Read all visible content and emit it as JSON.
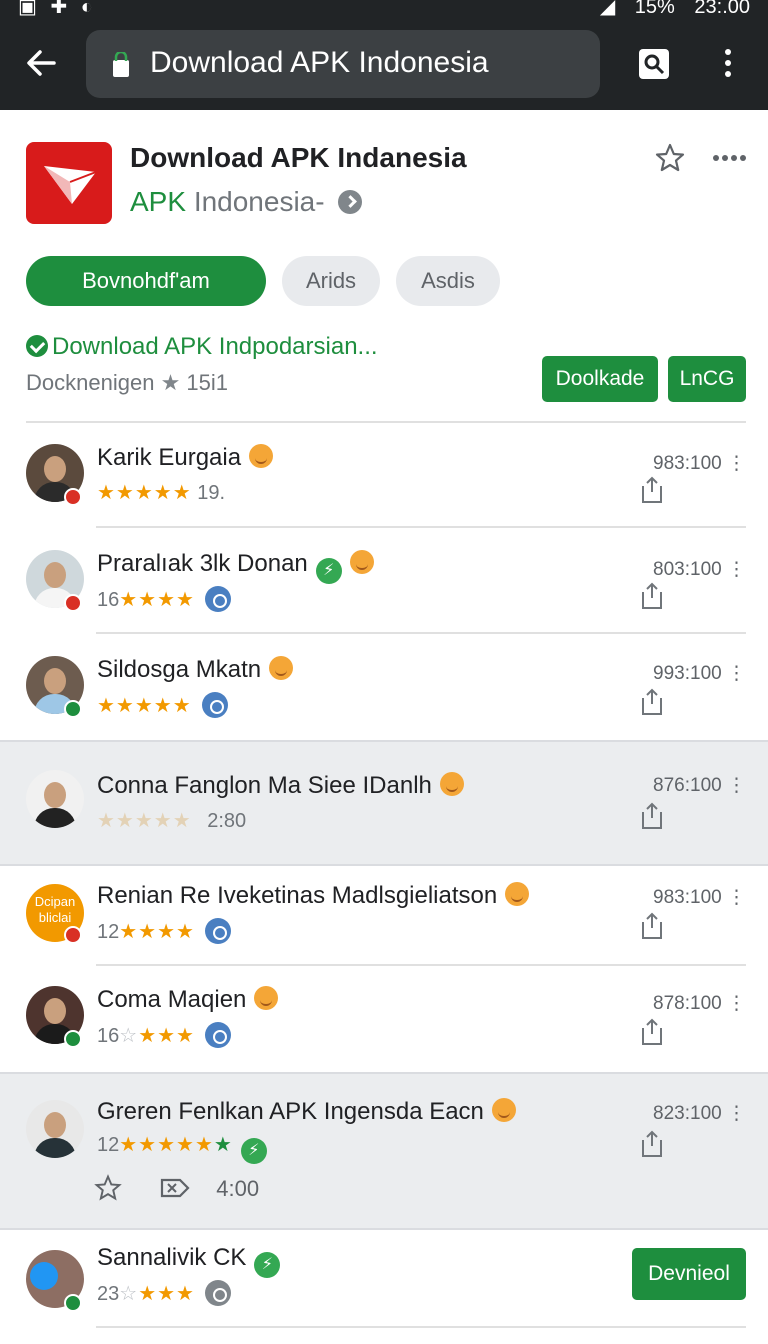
{
  "browser": {
    "url_text": "Download APK Indonesia",
    "status_time": "23:.00",
    "battery": "15%"
  },
  "app": {
    "title": "Download APK Indanesia",
    "developer_brand": "APK",
    "developer_rest": "Indonesia-",
    "chips": [
      "Bovnohdf'am",
      "Arids",
      "Asdis"
    ]
  },
  "summary": {
    "title": "Download APK Indpodarsian...",
    "meta_prefix": "Docknenigen",
    "meta_value": "15i1",
    "btn_primary": "Doolkade",
    "btn_secondary": "LnCG"
  },
  "reviews": [
    {
      "name": "Karik Eurgaia",
      "meta": "19.",
      "timer": "983:100"
    },
    {
      "name": "Praralıak 3lk Donan",
      "meta": "16",
      "timer": "803:100"
    },
    {
      "name": "Sildosga Mkatn",
      "meta": "",
      "timer": "993:100"
    },
    {
      "name": "Conna Fanglon Ma Siee IDanlh",
      "meta": "2:80",
      "timer": "876:100"
    },
    {
      "name": "Renian Re Ivеketinas Madlsgieliatson",
      "meta": "12",
      "avatar_text": "Dcipan bliclai",
      "timer": "983:100"
    },
    {
      "name": "Coma Maqien",
      "meta": "16",
      "timer": "878:100"
    },
    {
      "name": "Greren Fenlkan APK Ingensda Eacn",
      "meta": "12",
      "extra_time": "4:00",
      "timer": "823:100"
    },
    {
      "name": "Sannalivik CK",
      "meta": "23",
      "timer": "",
      "button": "Devnieol"
    }
  ],
  "colors": {
    "accent_green": "#1e8e3e",
    "app_icon_red": "#d81b1b",
    "top_bar": "#212426",
    "star": "#f29900"
  }
}
